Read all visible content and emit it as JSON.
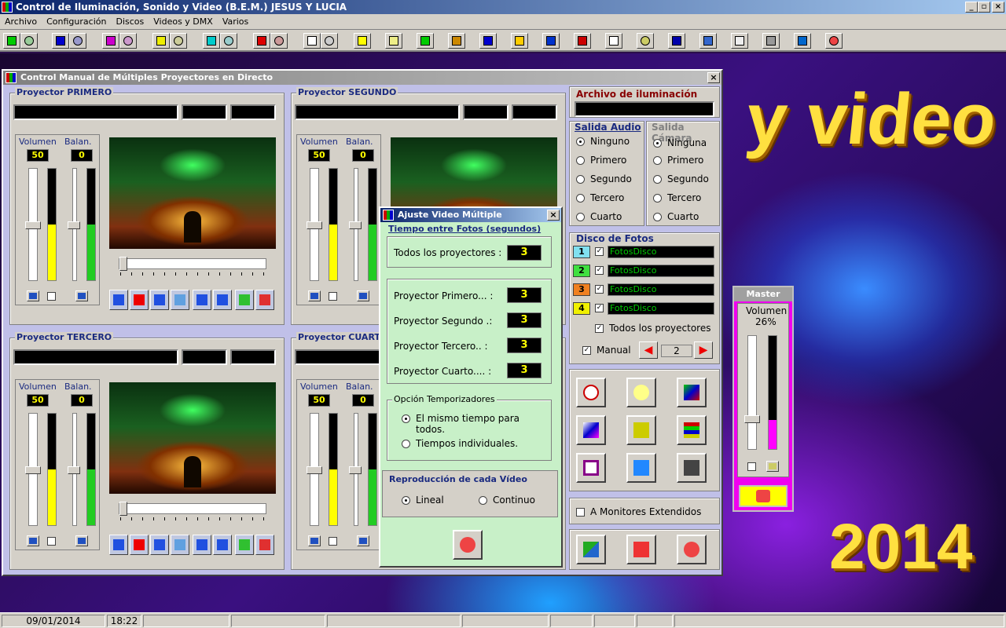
{
  "app": {
    "title": "Control de Iluminación, Sonido y Video (B.E.M.)  JESUS Y LUCIA"
  },
  "menu": [
    "Archivo",
    "Configuración",
    "Discos",
    "Videos y DMX",
    "Varios"
  ],
  "background": {
    "text1": "y video",
    "text2": "2014"
  },
  "main_window": {
    "title": "Control Manual de Múltiples Proyectores en Directo",
    "projectors": [
      {
        "title": "Proyector PRIMERO",
        "volume_label": "Volumen",
        "balance_label": "Balan.",
        "volume": "50",
        "balance": "0"
      },
      {
        "title": "Proyector SEGUNDO",
        "volume_label": "Volumen",
        "balance_label": "Balan.",
        "volume": "50",
        "balance": "0"
      },
      {
        "title": "Proyector TERCERO",
        "volume_label": "Volumen",
        "balance_label": "Balan.",
        "volume": "50",
        "balance": "0"
      },
      {
        "title": "Proyector CUARTO",
        "volume_label": "Volumen",
        "balance_label": "Balan.",
        "volume": "50",
        "balance": "0"
      }
    ],
    "archivo_label": "Archivo de iluminación",
    "salida_audio": {
      "label": "Salida Audio",
      "options": [
        "Ninguno",
        "Primero",
        "Segundo",
        "Tercero",
        "Cuarto"
      ],
      "selected": "Ninguno"
    },
    "salida_camara": {
      "label": "Salida Cámara",
      "options": [
        "Ninguna",
        "Primero",
        "Segundo",
        "Tercero",
        "Cuarto"
      ],
      "selected": "Ninguna"
    },
    "disco_fotos": {
      "label": "Disco de Fotos",
      "items": [
        {
          "num": "1",
          "name": "FotosDisco",
          "color": "#80e0f0"
        },
        {
          "num": "2",
          "name": "FotosDisco",
          "color": "#40e040"
        },
        {
          "num": "3",
          "name": "FotosDisco",
          "color": "#f08020"
        },
        {
          "num": "4",
          "name": "FotosDisco",
          "color": "#f0f000"
        }
      ],
      "todos_label": "Todos los proyectores",
      "manual_label": "Manual",
      "manual_value": "2"
    },
    "monitores_label": "A Monitores Extendidos"
  },
  "dialog": {
    "title": "Ajuste Video Múltiple",
    "tiempo_label": "Tiempo entre Fotos (segundos)",
    "todos_label": "Todos los proyectores :",
    "todos_value": "3",
    "rows": [
      {
        "label": "Proyector Primero... :",
        "value": "3"
      },
      {
        "label": "Proyector Segundo .:",
        "value": "3"
      },
      {
        "label": "Proyector Tercero.. :",
        "value": "3"
      },
      {
        "label": "Proyector Cuarto.... :",
        "value": "3"
      }
    ],
    "temporizadores_label": "Opción Temporizadores",
    "temp_options": [
      "El mismo tiempo para todos.",
      "Tiempos individuales."
    ],
    "reproduccion_label": "Reproducción de cada Vídeo",
    "repro_options": [
      "Lineal",
      "Continuo"
    ]
  },
  "master": {
    "title": "Master",
    "volume_label": "Volumen",
    "volume": "26%"
  },
  "status": {
    "date": "09/01/2014",
    "time": "18:22"
  }
}
